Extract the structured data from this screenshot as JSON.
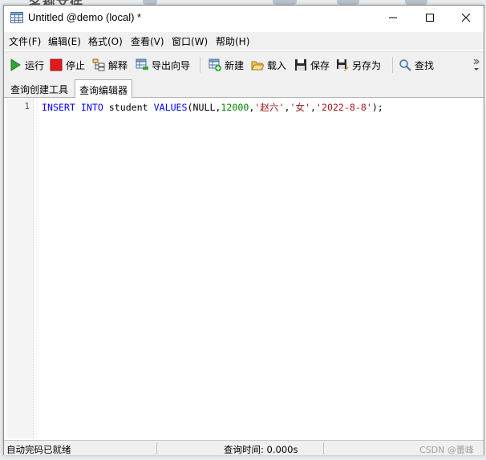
{
  "window": {
    "title": "Untitled @demo (local) *"
  },
  "menu": {
    "items": [
      "文件(F)",
      "编辑(E)",
      "格式(O)",
      "查看(V)",
      "窗口(W)",
      "帮助(H)"
    ]
  },
  "toolbar": {
    "run": {
      "label": "运行",
      "icon": "play-icon"
    },
    "stop": {
      "label": "停止",
      "icon": "stop-icon"
    },
    "explain": {
      "label": "解释",
      "icon": "explain-icon"
    },
    "export": {
      "label": "导出向导",
      "icon": "export-wizard-icon"
    },
    "new": {
      "label": "新建",
      "icon": "new-query-icon"
    },
    "load": {
      "label": "载入",
      "icon": "folder-open-icon"
    },
    "save": {
      "label": "保存",
      "icon": "save-icon"
    },
    "save_as": {
      "label": "另存为",
      "icon": "save-as-icon"
    },
    "find": {
      "label": "查找",
      "icon": "magnifier-icon"
    }
  },
  "tabs": [
    {
      "label": "查询创建工具",
      "active": false
    },
    {
      "label": "查询编辑器",
      "active": true
    }
  ],
  "editor": {
    "line_number": "1",
    "tokens": {
      "insert": "INSERT",
      "into": "INTO",
      "table": "student",
      "values": "VALUES",
      "args_open": "(NULL,",
      "num": "12000",
      "comma1": ",",
      "str1": "'赵六'",
      "comma2": ",",
      "str2": "'女'",
      "comma3": ",",
      "str3": "'2022-8-8'",
      "close": ");"
    },
    "colors": {
      "keyword": "#0000ff",
      "number": "#008000",
      "string": "#a31515"
    }
  },
  "status": {
    "left": "自动完码已就绪",
    "query_time": "查询时间: 0.000s"
  },
  "watermark": "CSDN @蕾峰",
  "background": {
    "fragment_text": "名称文件"
  }
}
